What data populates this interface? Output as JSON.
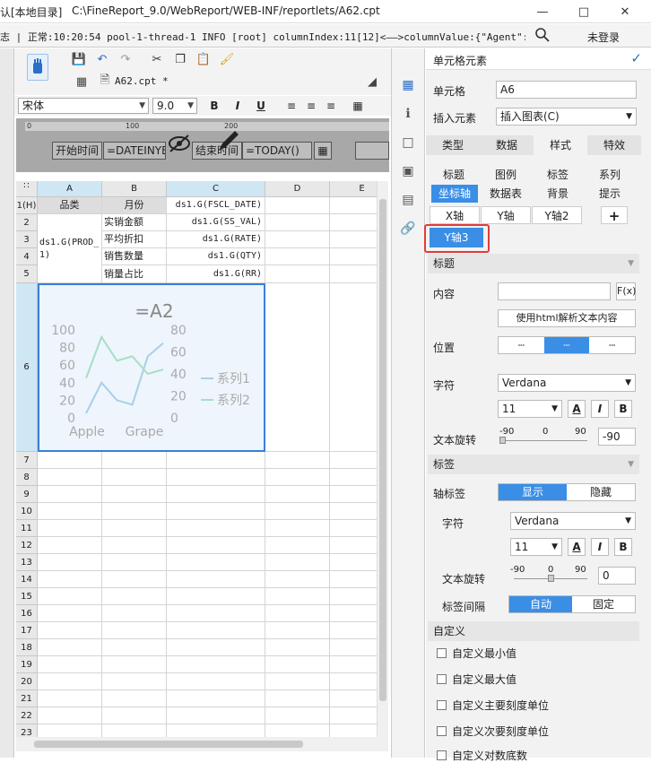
{
  "title_bar": {
    "left_label": "认[本地目录]",
    "path": "C:\\FineReport_9.0/WebReport/WEB-INF/reportlets/A62.cpt"
  },
  "log_bar": {
    "text": "志 | 正常:10:20:54 pool-1-thread-1 INFO [root] columnIndex:11[12]<——>columnValue:{\"Agent\":\"moz...",
    "login": "未登录"
  },
  "editor": {
    "tab_label": "A62.cpt *",
    "font_name": "宋体",
    "font_size": "9.0",
    "bold": "B",
    "italic": "I",
    "underline": "U"
  },
  "params": {
    "ruler_0": "0",
    "ruler_100": "100",
    "ruler_200": "200",
    "start_label": "开始时间",
    "start_value": "=DATEINYE",
    "end_label": "结束时间",
    "end_value": "=TODAY()"
  },
  "grid": {
    "col_headers": [
      "A",
      "B",
      "C",
      "D",
      "E"
    ],
    "row_labels": [
      "1(H)",
      "2",
      "3",
      "4",
      "5",
      "6",
      "7",
      "8",
      "9",
      "10",
      "11",
      "12",
      "13",
      "14",
      "15",
      "16",
      "17",
      "18",
      "19",
      "20",
      "21",
      "22",
      "23"
    ],
    "a1": "品类",
    "b1": "月份",
    "c1": "ds1.G(FSCL_DATE)",
    "a3": "ds1.G(PROD_",
    "a4": "1)",
    "b2": "实销金额",
    "b3": "平均折扣",
    "b4": "销售数量",
    "b5": "销量占比",
    "c2": "ds1.G(SS_VAL)",
    "c3": "ds1.G(RATE)",
    "c4": "ds1.G(QTY)",
    "c5": "ds1.G(RR)"
  },
  "chart_data": {
    "type": "line",
    "title": "=A2",
    "categories": [
      "Apple",
      "Grape"
    ],
    "y_left": {
      "ticks": [
        "100",
        "80",
        "60",
        "40",
        "20",
        "0"
      ],
      "ylim": [
        0,
        100
      ]
    },
    "y_right": {
      "ticks": [
        "80",
        "60",
        "40",
        "20",
        "0"
      ],
      "ylim": [
        0,
        80
      ]
    },
    "series": [
      {
        "name": "系列1",
        "values": [
          5,
          40,
          20,
          15,
          70,
          85
        ],
        "color": "#a8cfe6"
      },
      {
        "name": "系列2",
        "values": [
          45,
          92,
          65,
          70,
          50,
          55
        ],
        "color": "#a6dfc4"
      }
    ],
    "legend": "right"
  },
  "panel": {
    "header": "单元格元素",
    "cell_label": "单元格",
    "cell_value": "A6",
    "insert_label": "插入元素",
    "insert_value": "插入图表(C)",
    "main_tabs": [
      "类型",
      "数据",
      "样式",
      "特效"
    ],
    "style_tabs_row1": [
      "标题",
      "图例",
      "标签",
      "系列"
    ],
    "style_tabs_row2": [
      "坐标轴",
      "数据表",
      "背景",
      "提示"
    ],
    "axis_tabs": [
      "X轴",
      "Y轴",
      "Y轴2"
    ],
    "add_label": "+",
    "y3_label": "Y轴3",
    "sec_title": "标题",
    "content_label": "内容",
    "fx_label": "F(x)",
    "html_btn": "使用html解析文本内容",
    "position_label": "位置",
    "char_label": "字符",
    "font_value": "Verdana",
    "size_value": "11",
    "rotate_label": "文本旋转",
    "rot_min": "-90",
    "rot_mid": "0",
    "rot_max": "90",
    "rot_value": "-90",
    "sec_label": "标签",
    "axis_label_label": "轴标签",
    "show": "显示",
    "hide": "隐藏",
    "char2_label": "字符",
    "font2_value": "Verdana",
    "size2_value": "11",
    "rotate2_label": "文本旋转",
    "rot2_value": "0",
    "interval_label": "标签间隔",
    "auto": "自动",
    "fixed": "固定",
    "sec_custom": "自定义",
    "checks": [
      "自定义最小值",
      "自定义最大值",
      "自定义主要刻度单位",
      "自定义次要刻度单位",
      "自定义对数底数"
    ]
  }
}
